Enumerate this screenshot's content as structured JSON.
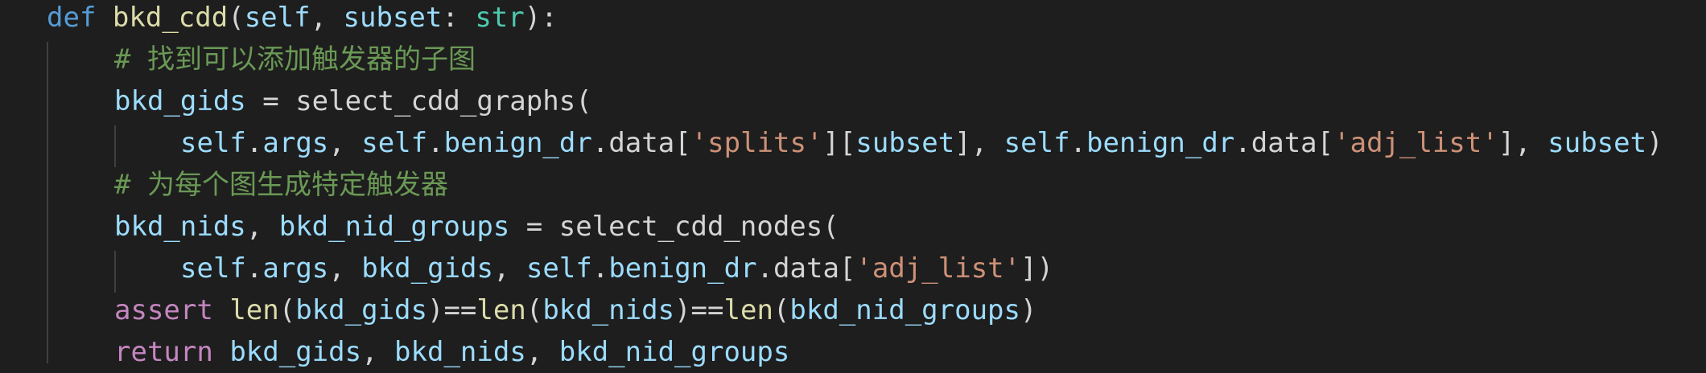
{
  "editor": {
    "lines": [
      {
        "indent": 0,
        "tokens": [
          {
            "t": "def",
            "c": "keyword"
          },
          {
            "t": " ",
            "c": "plain"
          },
          {
            "t": "bkd_cdd",
            "c": "func"
          },
          {
            "t": "(",
            "c": "punct"
          },
          {
            "t": "self",
            "c": "param"
          },
          {
            "t": ", ",
            "c": "punct"
          },
          {
            "t": "subset",
            "c": "param"
          },
          {
            "t": ": ",
            "c": "punct"
          },
          {
            "t": "str",
            "c": "type"
          },
          {
            "t": "):",
            "c": "punct"
          }
        ]
      },
      {
        "indent": 1,
        "tokens": [
          {
            "t": "# 找到可以添加触发器的子图",
            "c": "comment"
          }
        ]
      },
      {
        "indent": 1,
        "tokens": [
          {
            "t": "bkd_gids",
            "c": "param"
          },
          {
            "t": " = ",
            "c": "plain"
          },
          {
            "t": "select_cdd_graphs",
            "c": "plain"
          },
          {
            "t": "(",
            "c": "punct"
          }
        ]
      },
      {
        "indent": 2,
        "tokens": [
          {
            "t": "self",
            "c": "param"
          },
          {
            "t": ".",
            "c": "punct"
          },
          {
            "t": "args",
            "c": "param"
          },
          {
            "t": ", ",
            "c": "punct"
          },
          {
            "t": "self",
            "c": "param"
          },
          {
            "t": ".",
            "c": "punct"
          },
          {
            "t": "benign_dr",
            "c": "param"
          },
          {
            "t": ".",
            "c": "punct"
          },
          {
            "t": "data",
            "c": "plain"
          },
          {
            "t": "[",
            "c": "punct"
          },
          {
            "t": "'splits'",
            "c": "string"
          },
          {
            "t": "][",
            "c": "punct"
          },
          {
            "t": "subset",
            "c": "param"
          },
          {
            "t": "], ",
            "c": "punct"
          },
          {
            "t": "self",
            "c": "param"
          },
          {
            "t": ".",
            "c": "punct"
          },
          {
            "t": "benign_dr",
            "c": "param"
          },
          {
            "t": ".",
            "c": "punct"
          },
          {
            "t": "data",
            "c": "plain"
          },
          {
            "t": "[",
            "c": "punct"
          },
          {
            "t": "'adj_list'",
            "c": "string"
          },
          {
            "t": "], ",
            "c": "punct"
          },
          {
            "t": "subset",
            "c": "param"
          },
          {
            "t": ")",
            "c": "punct"
          }
        ]
      },
      {
        "indent": 1,
        "tokens": [
          {
            "t": "# 为每个图生成特定触发器",
            "c": "comment"
          }
        ]
      },
      {
        "indent": 1,
        "tokens": [
          {
            "t": "bkd_nids",
            "c": "param"
          },
          {
            "t": ", ",
            "c": "punct"
          },
          {
            "t": "bkd_nid_groups",
            "c": "param"
          },
          {
            "t": " = ",
            "c": "plain"
          },
          {
            "t": "select_cdd_nodes",
            "c": "plain"
          },
          {
            "t": "(",
            "c": "punct"
          }
        ]
      },
      {
        "indent": 2,
        "tokens": [
          {
            "t": "self",
            "c": "param"
          },
          {
            "t": ".",
            "c": "punct"
          },
          {
            "t": "args",
            "c": "param"
          },
          {
            "t": ", ",
            "c": "punct"
          },
          {
            "t": "bkd_gids",
            "c": "param"
          },
          {
            "t": ", ",
            "c": "punct"
          },
          {
            "t": "self",
            "c": "param"
          },
          {
            "t": ".",
            "c": "punct"
          },
          {
            "t": "benign_dr",
            "c": "param"
          },
          {
            "t": ".",
            "c": "punct"
          },
          {
            "t": "data",
            "c": "plain"
          },
          {
            "t": "[",
            "c": "punct"
          },
          {
            "t": "'adj_list'",
            "c": "string"
          },
          {
            "t": "])",
            "c": "punct"
          }
        ]
      },
      {
        "indent": 1,
        "tokens": [
          {
            "t": "assert",
            "c": "control"
          },
          {
            "t": " ",
            "c": "plain"
          },
          {
            "t": "len",
            "c": "func"
          },
          {
            "t": "(",
            "c": "punct"
          },
          {
            "t": "bkd_gids",
            "c": "param"
          },
          {
            "t": ")==",
            "c": "punct"
          },
          {
            "t": "len",
            "c": "func"
          },
          {
            "t": "(",
            "c": "punct"
          },
          {
            "t": "bkd_nids",
            "c": "param"
          },
          {
            "t": ")==",
            "c": "punct"
          },
          {
            "t": "len",
            "c": "func"
          },
          {
            "t": "(",
            "c": "punct"
          },
          {
            "t": "bkd_nid_groups",
            "c": "param"
          },
          {
            "t": ")",
            "c": "punct"
          }
        ]
      },
      {
        "indent": 1,
        "tokens": [
          {
            "t": "return",
            "c": "control"
          },
          {
            "t": " ",
            "c": "plain"
          },
          {
            "t": "bkd_gids",
            "c": "param"
          },
          {
            "t": ", ",
            "c": "punct"
          },
          {
            "t": "bkd_nids",
            "c": "param"
          },
          {
            "t": ", ",
            "c": "punct"
          },
          {
            "t": "bkd_nid_groups",
            "c": "param"
          }
        ]
      }
    ]
  },
  "colors": {
    "background": "#1e1e1e",
    "keyword": "#569cd6",
    "function": "#dcdcaa",
    "parameter": "#9cdcfe",
    "type": "#4ec9b0",
    "comment": "#6a9955",
    "string": "#ce9178",
    "control": "#c586c0",
    "plain": "#d4d4d4",
    "indent_guide": "#404040"
  }
}
